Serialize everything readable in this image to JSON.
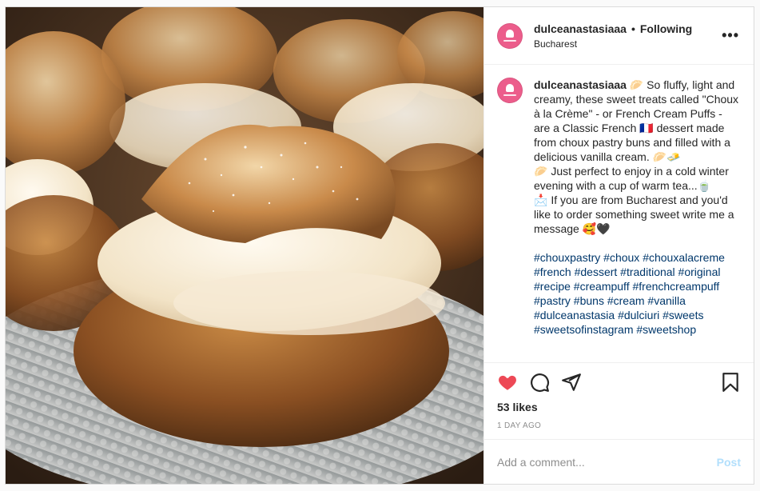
{
  "header": {
    "username": "dulceanastasiaaa",
    "separator": "•",
    "follow_status": "Following",
    "location": "Bucharest",
    "more_label": "•••"
  },
  "caption": {
    "username": "dulceanastasiaaa",
    "text_1": " 🥟 So fluffy, light and creamy, these sweet treats called \"Choux à la Crème\" - or French Cream Puffs - are a Classic French 🇨🇵 dessert made from choux pastry buns and filled with a delicious vanilla cream. 🥟🧈\n🥟 Just perfect to enjoy in a cold winter evening with a cup of warm tea...🍵\n📩 If you are from Bucharest and you'd like to order something sweet write me a message 🥰🖤",
    "hashtags": "#chouxpastry #choux #chouxalacreme #french #dessert #traditional #original #recipe #creampuff #frenchcreampuff #pastry #buns #cream #vanilla #dulceanastasia #dulciuri #sweets #sweetsofinstagram #sweetshop"
  },
  "actions": {
    "like_icon": "heart-filled-icon",
    "comment_icon": "comment-icon",
    "share_icon": "paper-plane-icon",
    "save_icon": "bookmark-icon",
    "like_color": "#ed4956"
  },
  "likes": "53 likes",
  "timestamp": "1 DAY AGO",
  "comment": {
    "placeholder": "Add a comment...",
    "post_label": "Post",
    "post_color": "#b2dffc"
  },
  "brand_color": "#ec5d8b"
}
